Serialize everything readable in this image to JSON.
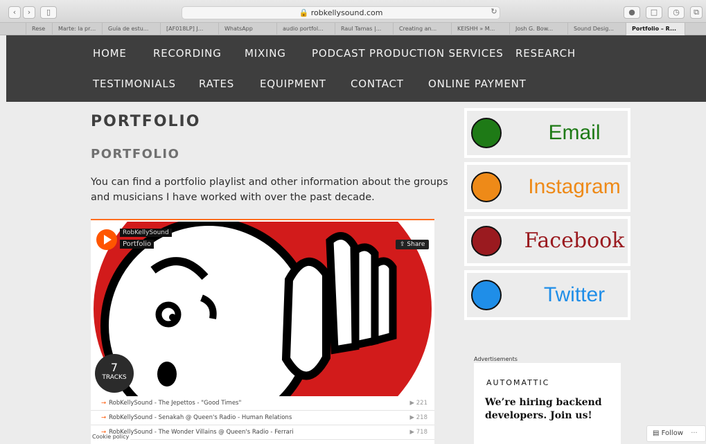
{
  "browser": {
    "url": "robkellysound.com",
    "tabs": [
      "Rese",
      "Marte: la pró...",
      "Guía de estu...",
      "[AF018LP] J...",
      "WhatsApp",
      "audio portfol...",
      "Raul Tamas |...",
      "Creating an...",
      "KEISHH » M...",
      "Josh G. Bow...",
      "Sound Desig...",
      "Portfolio – R..."
    ]
  },
  "nav": {
    "row1": [
      "HOME",
      "RECORDING",
      "MIXING",
      "PODCAST PRODUCTION SERVICES",
      "RESEARCH"
    ],
    "row2": [
      "TESTIMONIALS",
      "RATES",
      "EQUIPMENT",
      "CONTACT",
      "ONLINE PAYMENT"
    ]
  },
  "page": {
    "title": "PORTFOLIO",
    "subtitle": "PORTFOLIO",
    "intro": "You can find a portfolio playlist and other information about the groups and musicians I have worked with over the past decade."
  },
  "player": {
    "user": "RobKellySound",
    "playlist": "Portfolio",
    "share_label": "Share",
    "count": "7",
    "count_label": "TRACKS",
    "cookie": "Cookie policy",
    "tracks": [
      {
        "title": "RobKellySound - The Jepettos - \"Good Times\"",
        "plays": "221"
      },
      {
        "title": "RobKellySound - Senakah @ Queen's Radio - Human Relations",
        "plays": "218"
      },
      {
        "title": "RobKellySound - The Wonder Villains @ Queen's Radio - Ferrari",
        "plays": "718"
      }
    ]
  },
  "sidebar": {
    "social": [
      {
        "label": "Email",
        "color": "#1e7a16"
      },
      {
        "label": "Instagram",
        "color": "#ee8a18"
      },
      {
        "label": "Facebook",
        "color": "#9a1a1f"
      },
      {
        "label": "Twitter",
        "color": "#1f8ee8"
      }
    ],
    "ads_label": "Advertisements",
    "ad_brand": "AUTOMATTIC",
    "ad_copy": "We’re hiring backend developers. Join us!",
    "follow_label": "Follow"
  }
}
